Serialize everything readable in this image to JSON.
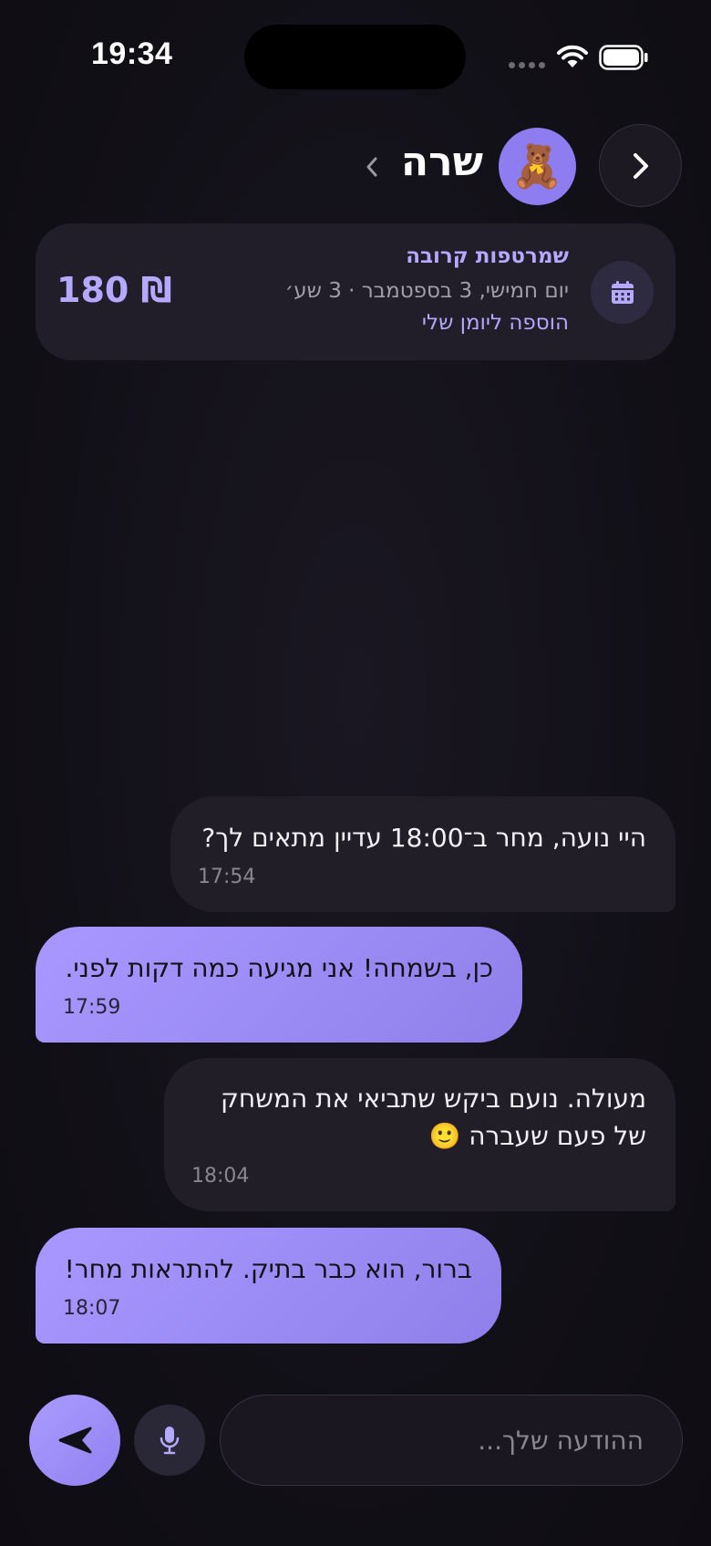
{
  "status_bar": {
    "time": "19:34"
  },
  "header": {
    "contact_name": "שרה",
    "avatar_emoji": "🧸",
    "back_icon": "chevron-right-icon",
    "detail_icon": "chevron-left-icon"
  },
  "booking": {
    "title": "שמרטפות קרובה",
    "date": "יום חמישי, 3 בספטמבר · 3 שע׳",
    "add_to_calendar": "הוספה ליומן שלי",
    "price": "180 ₪",
    "icon": "calendar-icon"
  },
  "messages": [
    {
      "direction": "out",
      "text": "היי נועה, מחר ב־18:00 עדיין מתאים לך?",
      "time": "17:54"
    },
    {
      "direction": "in",
      "text": "כן, בשמחה! אני מגיעה כמה דקות לפני.",
      "time": "17:59"
    },
    {
      "direction": "out",
      "text_line1": "מעולה. נועם ביקש שתביאי את המשחק",
      "text_line2": "של פעם שעברה 🙂",
      "time": "18:04"
    },
    {
      "direction": "in",
      "text": "ברור, הוא כבר בתיק. להתראות מחר!",
      "time": "18:07"
    }
  ],
  "composer": {
    "placeholder": "ההודעה שלך...",
    "value": "",
    "mic_icon": "microphone-icon",
    "send_icon": "send-icon"
  },
  "colors": {
    "accent": "#9d8df5",
    "background": "#121017",
    "bubble_out": "#211e28"
  }
}
